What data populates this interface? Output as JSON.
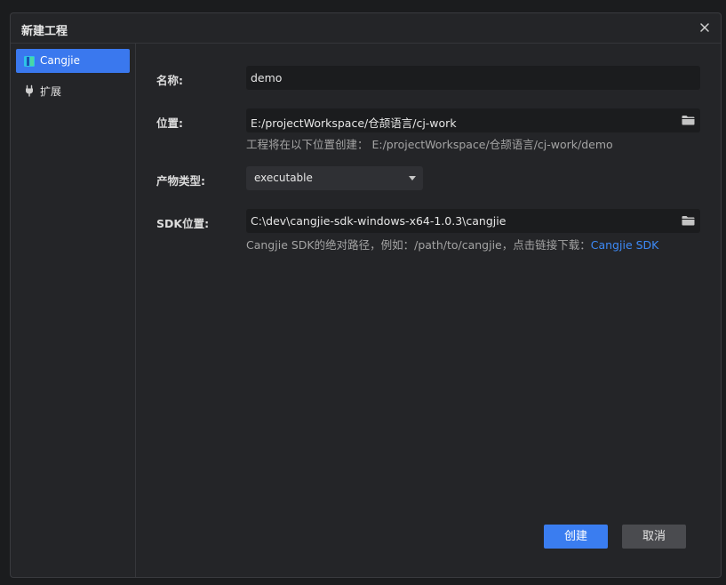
{
  "dialog": {
    "title": "新建工程",
    "close_icon": "close-icon"
  },
  "sidebar": {
    "items": [
      {
        "label": "Cangjie",
        "icon": "cangjie-logo-icon",
        "active": true
      },
      {
        "label": "扩展",
        "icon": "plug-icon",
        "active": false
      }
    ]
  },
  "form": {
    "name": {
      "label": "名称:",
      "value": "demo"
    },
    "location": {
      "label": "位置:",
      "value": "E:/projectWorkspace/仓颉语言/cj-work",
      "hint": "工程将在以下位置创建：  E:/projectWorkspace/仓颉语言/cj-work/demo",
      "icon": "folder-icon"
    },
    "artifact_type": {
      "label": "产物类型:",
      "value": "executable"
    },
    "sdk": {
      "label": "SDK位置:",
      "value": "C:\\dev\\cangjie-sdk-windows-x64-1.0.3\\cangjie",
      "hint": "Cangjie SDK的绝对路径，例如：/path/to/cangjie，点击链接下载：",
      "link": "Cangjie SDK",
      "icon": "folder-icon"
    }
  },
  "footer": {
    "create_label": "创建",
    "cancel_label": "取消"
  },
  "colors": {
    "accent": "#3a7df0",
    "link": "#3d8af7",
    "background": "#242528",
    "input_bg": "#1b1c1e"
  }
}
